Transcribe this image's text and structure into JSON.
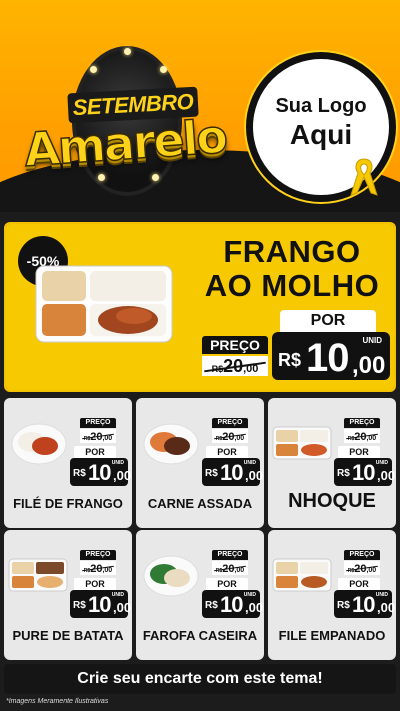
{
  "header": {
    "logo_line1": "SETEMBRO",
    "logo_line2": "Amarelo",
    "brand_line1": "Sua Logo",
    "brand_line2": "Aqui",
    "brand_icon": "ribbon-icon"
  },
  "feature": {
    "badge": "-50%",
    "title_line1": "FRANGO",
    "title_line2": "AO MOLHO",
    "preco_label": "PREÇO",
    "old_currency": "R$",
    "old_int": "20",
    "old_dec": ",00",
    "por_label": "POR",
    "unid_label": "UNID",
    "currency": "R$",
    "price_int": "10",
    "price_dec": ",00"
  },
  "price_labels": {
    "preco": "PREÇO",
    "por": "POR",
    "unid": "UNID",
    "currency": "R$",
    "old_int": "20",
    "old_dec": ",00",
    "new_int": "10",
    "new_dec": ",00"
  },
  "cards": [
    {
      "name": "FILÉ DE FRANGO"
    },
    {
      "name": "CARNE ASSADA"
    },
    {
      "name": "NHOQUE"
    },
    {
      "name": "PURE DE BATATA"
    },
    {
      "name": "FAROFA CASEIRA"
    },
    {
      "name": "FILE EMPANADO"
    }
  ],
  "footer": {
    "cta": "Crie seu encarte com este tema!",
    "disclaimer": "*Imagens Meramente Ilustrativas"
  },
  "colors": {
    "accent_yellow": "#f7c900",
    "dark": "#111111",
    "card_bg": "#e8e8e8"
  }
}
